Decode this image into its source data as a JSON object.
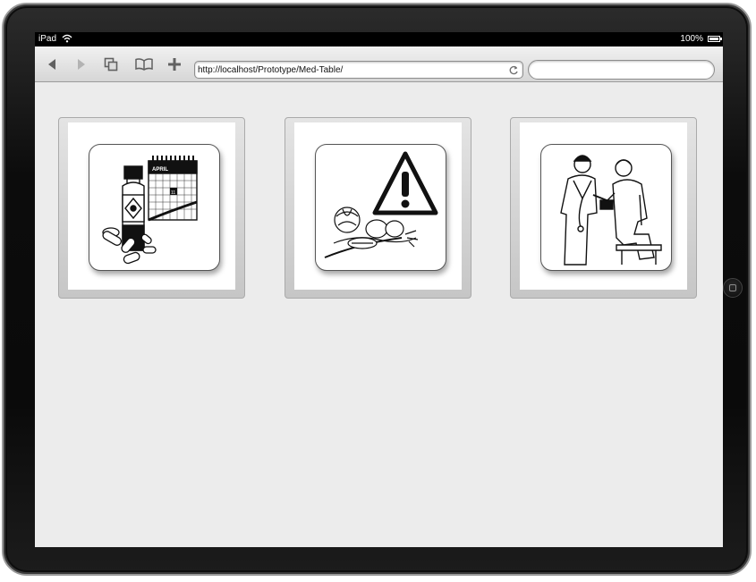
{
  "status_bar": {
    "carrier": "iPad",
    "battery": "100%"
  },
  "browser": {
    "url": "http://localhost/Prototype/Med-Table/",
    "search_placeholder": ""
  },
  "calendar": {
    "month": "APRIL",
    "highlighted_day": "11"
  }
}
